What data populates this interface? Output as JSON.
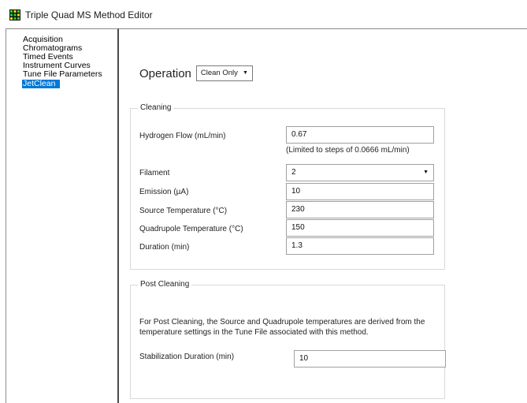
{
  "window": {
    "title": "Triple Quad MS Method Editor",
    "icon": "app-grid-icon"
  },
  "sidebar": {
    "items": [
      {
        "label": "Acquisition",
        "selected": false
      },
      {
        "label": "Chromatograms",
        "selected": false
      },
      {
        "label": "Timed Events",
        "selected": false
      },
      {
        "label": "Instrument Curves",
        "selected": false
      },
      {
        "label": "Tune File Parameters",
        "selected": false
      },
      {
        "label": "JetClean",
        "selected": true
      }
    ]
  },
  "operation": {
    "label": "Operation",
    "value": "Clean Only"
  },
  "cleaning": {
    "legend": "Cleaning",
    "hydrogen_flow": {
      "label": "Hydrogen Flow (mL/min)",
      "value": "0.67",
      "hint": "(Limited to steps of 0.0666 mL/min)"
    },
    "filament": {
      "label": "Filament",
      "value": "2"
    },
    "emission": {
      "label": "Emission (µA)",
      "value": "10"
    },
    "source_temp": {
      "label": "Source Temperature (°C)",
      "value": "230"
    },
    "quad_temp": {
      "label": "Quadrupole Temperature (°C)",
      "value": "150"
    },
    "duration": {
      "label": "Duration (min)",
      "value": "1.3"
    }
  },
  "post_cleaning": {
    "legend": "Post Cleaning",
    "description": "For Post Cleaning, the Source and Quadrupole temperatures are derived from the temperature settings in the Tune File associated with this method.",
    "stabilization": {
      "label": "Stabilization Duration (min)",
      "value": "10"
    }
  },
  "colors": {
    "selection": "#0078d7",
    "group_border": "#d9d9d9"
  }
}
